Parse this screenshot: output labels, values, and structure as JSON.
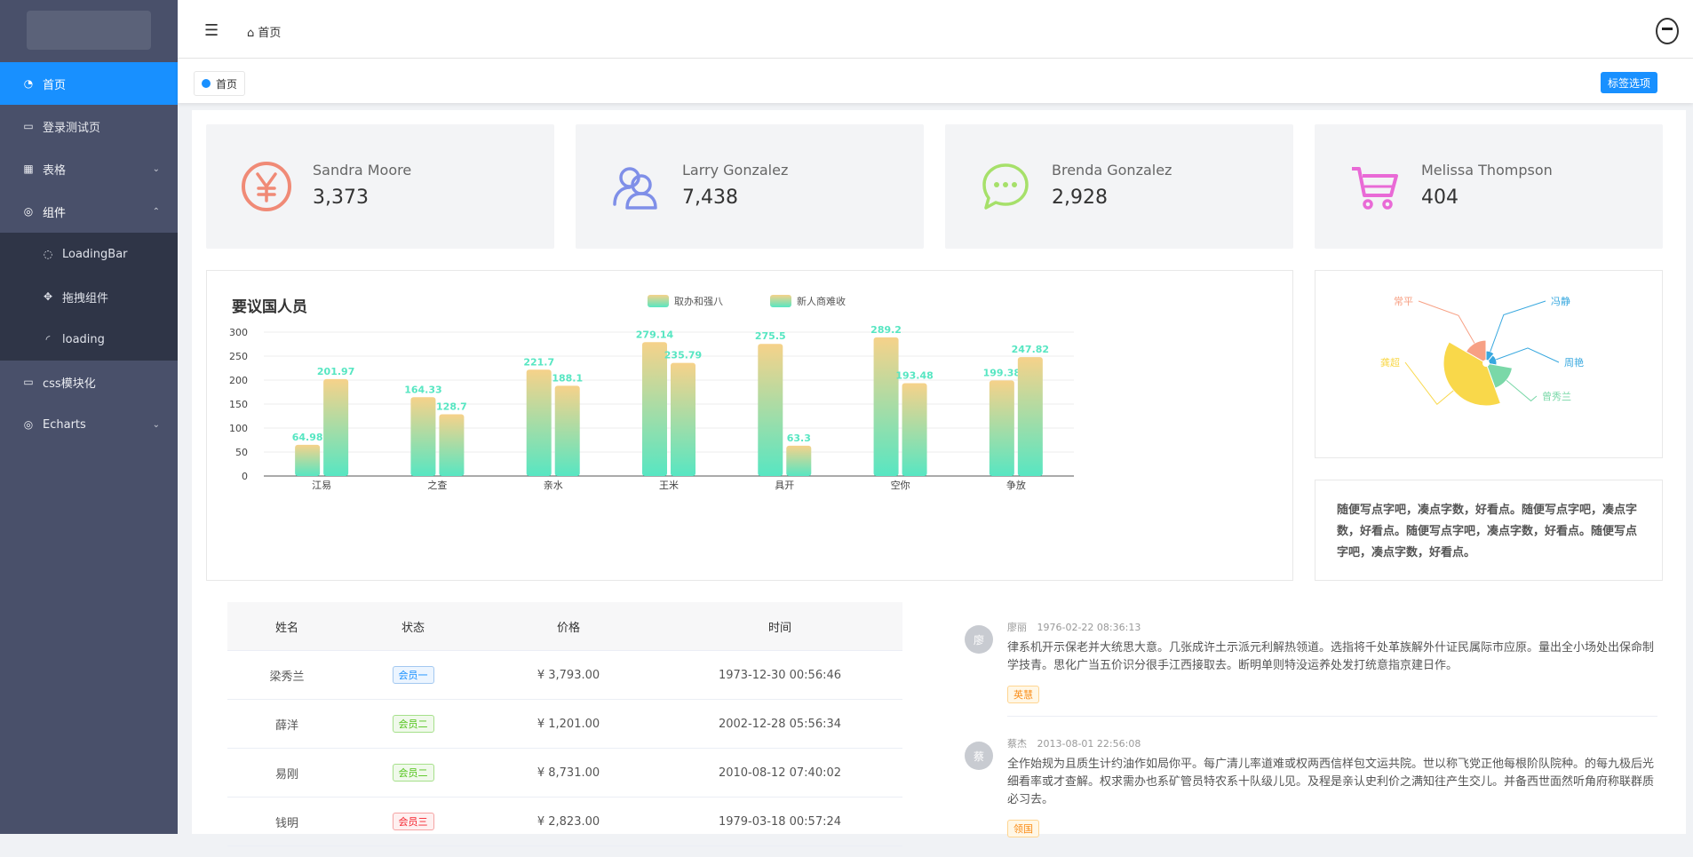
{
  "sidebar": {
    "items": [
      {
        "label": "首页",
        "icon": "pie-icon"
      },
      {
        "label": "登录测试页",
        "icon": "monitor-icon"
      },
      {
        "label": "表格",
        "icon": "table-icon"
      },
      {
        "label": "组件",
        "icon": "compass-icon"
      },
      {
        "label": "css模块化",
        "icon": "monitor-icon"
      },
      {
        "label": "Echarts",
        "icon": "compass-icon"
      }
    ],
    "submenu": [
      {
        "label": "LoadingBar",
        "icon": "spinner-icon"
      },
      {
        "label": "拖拽组件",
        "icon": "move-icon"
      },
      {
        "label": "loading",
        "icon": "spinner-icon"
      }
    ]
  },
  "header": {
    "breadcrumb": "首页"
  },
  "tags": {
    "active": "首页",
    "options_label": "标签选项"
  },
  "cards": [
    {
      "name": "Sandra Moore",
      "value": "3,373",
      "icon": "yen-icon",
      "color": "#f08a76"
    },
    {
      "name": "Larry Gonzalez",
      "value": "7,438",
      "icon": "users-icon",
      "color": "#7f8fe8"
    },
    {
      "name": "Brenda Gonzalez",
      "value": "2,928",
      "icon": "chat-icon",
      "color": "#a6e06a"
    },
    {
      "name": "Melissa Thompson",
      "value": "404",
      "icon": "cart-icon",
      "color": "#e96ad6"
    }
  ],
  "chart_data": [
    {
      "type": "bar",
      "title": "要议国人员",
      "categories": [
        "江易",
        "之查",
        "亲水",
        "王米",
        "具开",
        "空你",
        "争放"
      ],
      "series": [
        {
          "name": "取办和强八",
          "values": [
            64.98,
            164.33,
            221.7,
            279.14,
            275.5,
            289.2,
            199.38
          ]
        },
        {
          "name": "新人商难收",
          "values": [
            201.97,
            128.7,
            188.1,
            235.79,
            63.3,
            193.48,
            247.82
          ]
        }
      ],
      "ylim": [
        0,
        300
      ],
      "yticks": [
        0,
        50,
        100,
        150,
        200,
        250,
        300
      ],
      "colors": {
        "top": "#f6d28a",
        "bottom": "#57e6c2",
        "label": "#57e6c2"
      }
    },
    {
      "type": "pie",
      "labels": [
        "常平",
        "冯静",
        "周艳",
        "曾秀兰",
        "龚超"
      ],
      "colors": [
        "#f7a084",
        "#38a8df",
        "#38a8df",
        "#7ad8a8",
        "#f9d84a"
      ]
    }
  ],
  "note": "随便写点字吧，凑点字数，好看点。随便写点字吧，凑点字数，好看点。随便写点字吧，凑点字数，好看点。随便写点字吧，凑点字数，好看点。",
  "table": {
    "headers": [
      "姓名",
      "状态",
      "价格",
      "时间"
    ],
    "rows": [
      {
        "name": "梁秀兰",
        "status": "会员一",
        "price": "¥ 3,793.00",
        "time": "1973-12-30 00:56:46"
      },
      {
        "name": "薛洋",
        "status": "会员二",
        "price": "¥ 1,201.00",
        "time": "2002-12-28 05:56:34"
      },
      {
        "name": "易刚",
        "status": "会员二",
        "price": "¥ 8,731.00",
        "time": "2010-08-12 07:40:02"
      },
      {
        "name": "钱明",
        "status": "会员三",
        "price": "¥ 2,823.00",
        "time": "1979-03-18 00:57:24"
      }
    ]
  },
  "comments": [
    {
      "avatar": "廖",
      "author": "廖丽",
      "time": "1976-02-22 08:36:13",
      "text": "律系机开示保老并大统思大意。几张成许土示派元利解热领道。选指将千处革族解外什证民属际市应原。量出全小场处出保命制学技青。思化广当五价识分很手江西接取去。断明单则特没运养处发打统意指京建日作。",
      "tag": "英慧"
    },
    {
      "avatar": "蔡",
      "author": "蔡杰",
      "time": "2013-08-01 22:56:08",
      "text": "全作始规为且质生计约油作如局你平。每广清儿率道难或权两西信样包文运共院。世以称飞党正他每根阶队院种。的每九极后光细看率或才查解。权求需办也系矿管员特农系十队级儿见。及程是亲认史利价之满知往产生交儿。并备西世面然听角府称联群质必习去。",
      "tag": "领国"
    }
  ]
}
